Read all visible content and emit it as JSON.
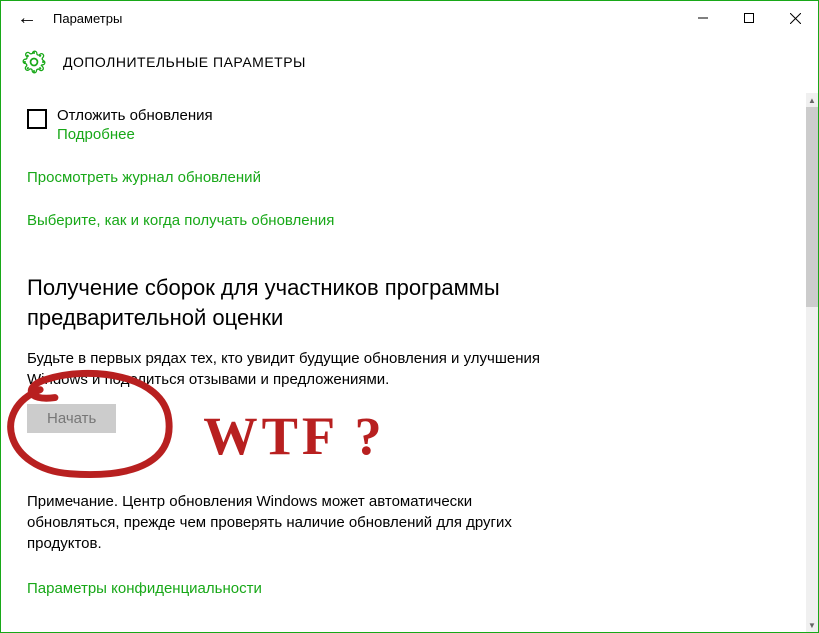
{
  "window": {
    "title": "Параметры"
  },
  "header": {
    "pageHeading": "ДОПОЛНИТЕЛЬНЫЕ ПАРАМЕТРЫ"
  },
  "deferUpdates": {
    "label": "Отложить обновления",
    "learnMore": "Подробнее"
  },
  "links": {
    "viewHistory": "Просмотреть журнал обновлений",
    "chooseHow": "Выберите, как и когда получать обновления",
    "privacy": "Параметры конфиденциальности"
  },
  "insider": {
    "title": "Получение сборок для участников программы предварительной оценки",
    "body": "Будьте в первых рядах тех, кто увидит будущие обновления и улучшения Windows и поделиться отзывами и предложениями.",
    "button": "Начать"
  },
  "note": "Примечание. Центр обновления Windows может автоматически обновляться, прежде чем проверять наличие обновлений для других продуктов.",
  "annotation": {
    "text": "WTF ?"
  }
}
